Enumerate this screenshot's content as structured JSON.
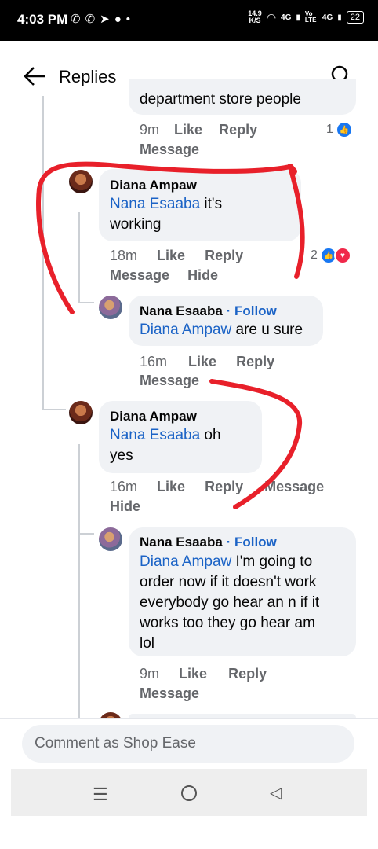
{
  "status_bar": {
    "time": "4:03 PM",
    "icons_left": [
      "whatsapp-icon",
      "whatsapp-business-icon",
      "telegram-icon",
      "mic-icon",
      "dot-icon"
    ],
    "speed": "14.9",
    "speed_unit": "K/S",
    "network1": "4G",
    "volte": "Vo LTE",
    "network2": "4G",
    "battery": "22"
  },
  "header": {
    "title": "Replies",
    "back_icon": "arrow-left-icon",
    "search_icon": "search-icon"
  },
  "comments": [
    {
      "text": "department store people",
      "time": "9m",
      "like": "Like",
      "reply": "Reply",
      "message": "Message",
      "reaction_count": "1"
    },
    {
      "author": "Diana Ampaw",
      "mention": "Nana Esaaba",
      "text_line1": " it's",
      "text_line2": "working",
      "time": "18m",
      "like": "Like",
      "reply": "Reply",
      "message": "Message",
      "hide": "Hide",
      "reaction_count": "2"
    },
    {
      "author": "Nana Esaaba",
      "follow": "· Follow",
      "mention": "Diana Ampaw",
      "text": " are u sure",
      "time": "16m",
      "like": "Like",
      "reply": "Reply",
      "message": "Message"
    },
    {
      "author": "Diana Ampaw",
      "mention": "Nana Esaaba",
      "text_line1": " oh",
      "text_line2": "yes",
      "time": "16m",
      "like": "Like",
      "reply": "Reply",
      "message": "Message",
      "hide": "Hide"
    },
    {
      "author": "Nana Esaaba",
      "follow": "· Follow",
      "mention": "Diana Ampaw",
      "text_line1": " I'm going to",
      "text_line2": "order now if it doesn't work",
      "text_line3": "everybody go hear an n if it",
      "text_line4": "works too they go hear am",
      "text_line5": "lol",
      "time": "9m",
      "like": "Like",
      "reply": "Reply",
      "message": "Message"
    }
  ],
  "composer": {
    "placeholder": "Comment as Shop Ease"
  },
  "nav": {
    "menu_icon": "menu-icon",
    "home_icon": "home-circle-icon",
    "back_icon": "back-triangle-icon"
  },
  "colors": {
    "mention": "#1b63c6",
    "annotation": "#e8202a",
    "bubble": "#f0f2f5"
  }
}
